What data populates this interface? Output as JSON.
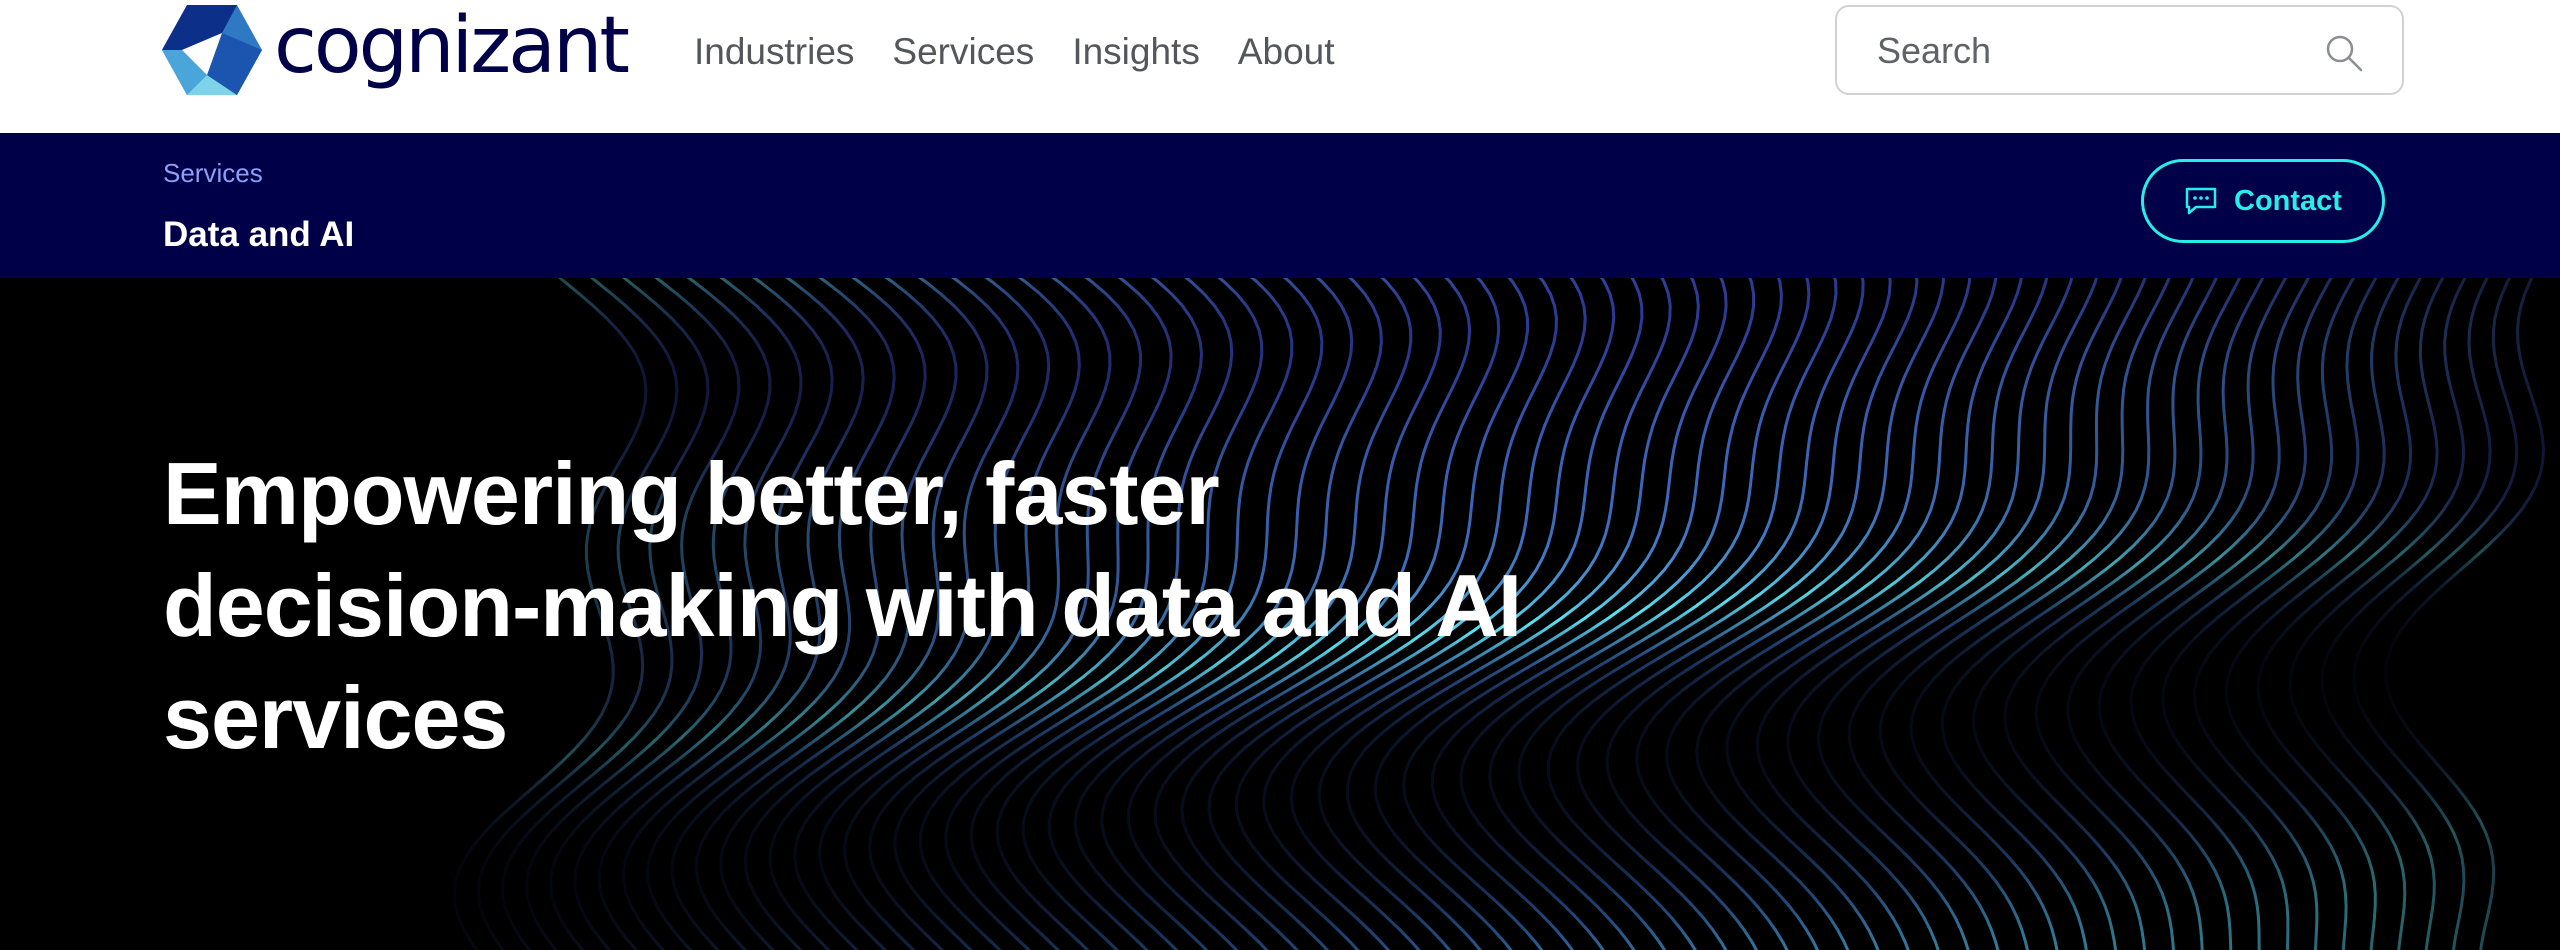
{
  "brand": {
    "wordmark": "cognizant"
  },
  "nav": {
    "items": [
      {
        "label": "Industries"
      },
      {
        "label": "Services"
      },
      {
        "label": "Insights"
      },
      {
        "label": "About"
      }
    ]
  },
  "search": {
    "placeholder": "Search",
    "value": ""
  },
  "subheader": {
    "breadcrumb": "Services",
    "page_name": "Data and AI",
    "contact_label": "Contact"
  },
  "hero": {
    "title": "Empowering better, faster decision-making with data and AI services"
  },
  "colors": {
    "brand_navy": "#000048",
    "accent_cyan": "#26efe9",
    "breadcrumb_blue": "#8ca0f5",
    "nav_gray": "#53565a"
  }
}
